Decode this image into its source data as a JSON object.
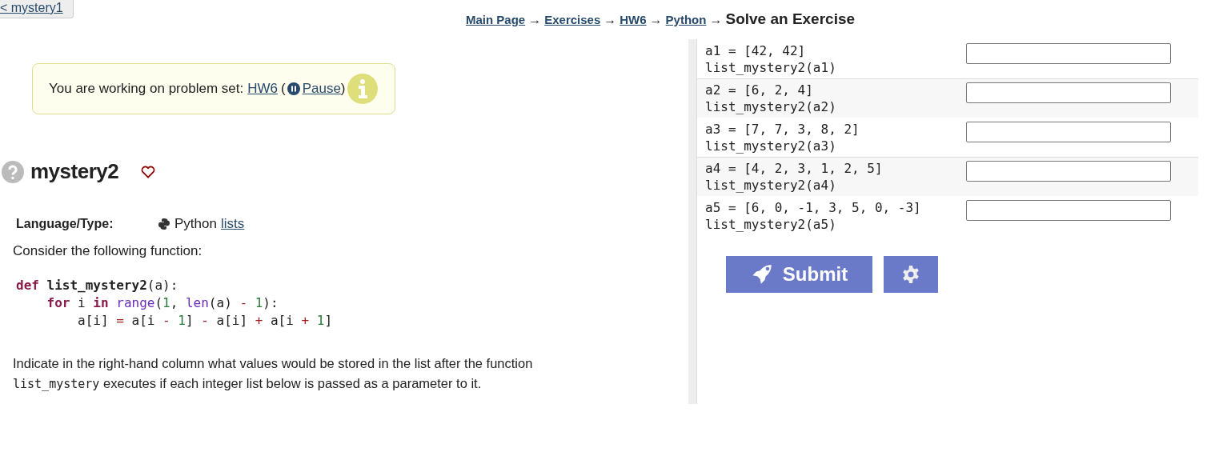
{
  "back_link": "< mystery1",
  "breadcrumb": {
    "links": [
      "Main Page",
      "Exercises",
      "HW6",
      "Python"
    ],
    "separator": "→",
    "current": "Solve an Exercise"
  },
  "notice": {
    "text": "You are working on problem set:",
    "set_link": "HW6",
    "open_paren": "(",
    "pause_link": "Pause",
    "close_paren": ")"
  },
  "problem": {
    "title": "mystery2",
    "favorite": false,
    "language_label": "Language/Type:",
    "language": "Python",
    "type_link": "lists",
    "intro": "Consider the following function:"
  },
  "code": [
    [
      {
        "text": "def",
        "kind": "keyword"
      },
      {
        "text": " list_mystery2",
        "kind": "name"
      },
      {
        "text": "(a):",
        "kind": "plain"
      }
    ],
    [
      {
        "text": "    for",
        "kind": "keyword"
      },
      {
        "text": " i ",
        "kind": "plain"
      },
      {
        "text": "in",
        "kind": "keyword"
      },
      {
        "text": " range",
        "kind": "builtin"
      },
      {
        "text": "(",
        "kind": "plain"
      },
      {
        "text": "1",
        "kind": "number"
      },
      {
        "text": ", ",
        "kind": "plain"
      },
      {
        "text": "len",
        "kind": "builtin"
      },
      {
        "text": "(a) ",
        "kind": "plain"
      },
      {
        "text": "-",
        "kind": "op"
      },
      {
        "text": " 1",
        "kind": "number"
      },
      {
        "text": "):",
        "kind": "plain"
      }
    ],
    [
      {
        "text": "        a[i] ",
        "kind": "plain"
      },
      {
        "text": "=",
        "kind": "op"
      },
      {
        "text": " a[i ",
        "kind": "plain"
      },
      {
        "text": "-",
        "kind": "op"
      },
      {
        "text": " 1",
        "kind": "number"
      },
      {
        "text": "] ",
        "kind": "plain"
      },
      {
        "text": "-",
        "kind": "op"
      },
      {
        "text": " a[i] ",
        "kind": "plain"
      },
      {
        "text": "+",
        "kind": "op"
      },
      {
        "text": " a[i ",
        "kind": "plain"
      },
      {
        "text": "+",
        "kind": "op"
      },
      {
        "text": " 1",
        "kind": "number"
      },
      {
        "text": "]",
        "kind": "plain"
      }
    ]
  ],
  "description": [
    {
      "text": "Indicate in the right-hand column what values would be stored in the list after the function ",
      "kind": "text"
    },
    {
      "text": "list_mystery",
      "kind": "code"
    },
    {
      "text": " executes if each integer list below is passed as a parameter to it.",
      "kind": "text"
    }
  ],
  "questions": [
    {
      "assign": "a1 = [42, 42]",
      "call": "list_mystery2(a1)"
    },
    {
      "assign": "a2 = [6, 2, 4]",
      "call": "list_mystery2(a2)"
    },
    {
      "assign": "a3 = [7, 7, 3, 8, 2]",
      "call": "list_mystery2(a3)"
    },
    {
      "assign": "a4 = [4, 2, 3, 1, 2, 5]",
      "call": "list_mystery2(a4)"
    },
    {
      "assign": "a5 = [6, 0, -1, 3, 5, 0, -3]",
      "call": "list_mystery2(a5)"
    }
  ],
  "submit_button": "Submit"
}
